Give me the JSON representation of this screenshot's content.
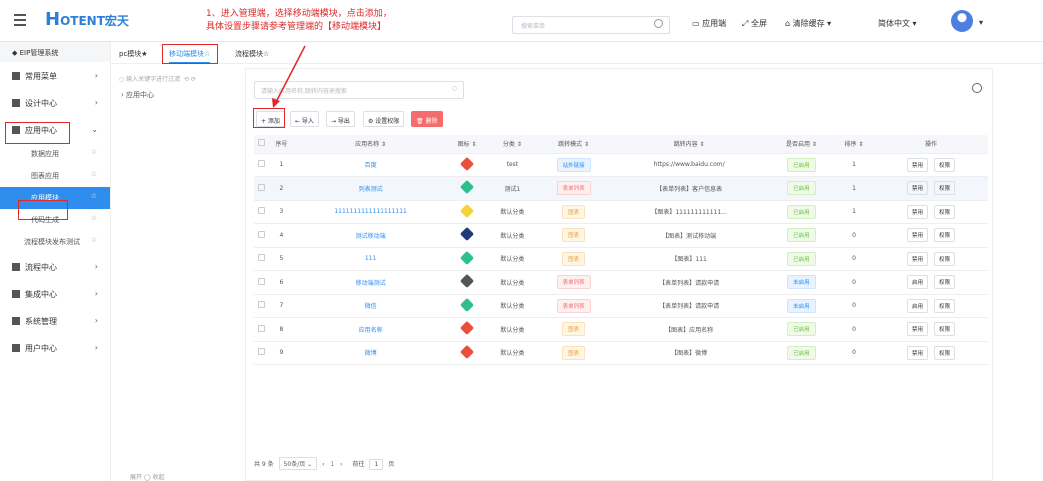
{
  "header": {
    "logo_main": "H",
    "logo_text": "OTENT",
    "logo_cn": "宏天",
    "hint_line1": "1、进入管理端，选择移动端模块，点击添加，",
    "hint_line2": "具体设置步骤请参考管理端的【移动端模块】",
    "search_placeholder": "搜索菜单",
    "app_end": "应用端",
    "fullscreen": "全屏",
    "clear_cache": "清除缓存",
    "language": "简体中文"
  },
  "sidebar": {
    "title": "EIP管理系统",
    "items": [
      {
        "label": "常用菜单"
      },
      {
        "label": "设计中心"
      },
      {
        "label": "应用中心"
      },
      {
        "label": "流程中心"
      },
      {
        "label": "集成中心"
      },
      {
        "label": "系统管理"
      },
      {
        "label": "用户中心"
      }
    ],
    "subitems": [
      "数据应用",
      "图表应用",
      "应用模块",
      "代码生成",
      "流程模块发布测试"
    ]
  },
  "tabs": [
    "pc模块★",
    "移动端模块☆",
    "流程模块☆"
  ],
  "tree": {
    "search_placeholder": "输入关键字进行过滤",
    "node": "应用中心"
  },
  "toolbar": {
    "key_placeholder": "请输入应用名称,跳转内容来搜索",
    "add": "+ 添加",
    "import": "← 导入",
    "export": "→ 导出",
    "perm": "⚙ 设置权限",
    "delete": "🗑 删除"
  },
  "table": {
    "headers": [
      "",
      "序号",
      "应用名称 ⇕",
      "图标 ⇕",
      "分类 ⇕",
      "跳转模式 ⇕",
      "跳转内容 ⇕",
      "是否启用 ⇕",
      "排序 ⇕",
      "操作"
    ],
    "rows": [
      {
        "no": "1",
        "name": "百度",
        "cat": "test",
        "mode": "站外链接",
        "content": "https://www.baidu.com/",
        "status": "已启用",
        "sort": "1",
        "op1": "禁用",
        "op2": "权限"
      },
      {
        "no": "2",
        "name": "列表测试",
        "cat": "测试1",
        "mode": "表单列表",
        "content": "【表单列表】客户信息表",
        "status": "已启用",
        "sort": "1",
        "op1": "禁用",
        "op2": "权限"
      },
      {
        "no": "3",
        "name": "1111111111111111111",
        "cat": "默认分类",
        "mode": "图表",
        "content": "【图表】111111111111...",
        "status": "已启用",
        "sort": "1",
        "op1": "禁用",
        "op2": "权限"
      },
      {
        "no": "4",
        "name": "测试移动端",
        "cat": "默认分类",
        "mode": "图表",
        "content": "【图表】测试移动端",
        "status": "已启用",
        "sort": "0",
        "op1": "禁用",
        "op2": "权限"
      },
      {
        "no": "5",
        "name": "111",
        "cat": "默认分类",
        "mode": "图表",
        "content": "【图表】111",
        "status": "已启用",
        "sort": "0",
        "op1": "禁用",
        "op2": "权限"
      },
      {
        "no": "6",
        "name": "移动端测试",
        "cat": "默认分类",
        "mode": "表单列表",
        "content": "【表单列表】请款申请",
        "status": "未启用",
        "sort": "0",
        "op1": "启用",
        "op2": "权限"
      },
      {
        "no": "7",
        "name": "微信",
        "cat": "默认分类",
        "mode": "表单列表",
        "content": "【表单列表】请款申请",
        "status": "未启用",
        "sort": "0",
        "op1": "启用",
        "op2": "权限"
      },
      {
        "no": "8",
        "name": "应用名称",
        "cat": "默认分类",
        "mode": "图表",
        "content": "【图表】应用名称",
        "status": "已启用",
        "sort": "0",
        "op1": "禁用",
        "op2": "权限"
      },
      {
        "no": "9",
        "name": "微博",
        "cat": "默认分类",
        "mode": "图表",
        "content": "【图表】微博",
        "status": "已启用",
        "sort": "0",
        "op1": "禁用",
        "op2": "权限"
      }
    ]
  },
  "pager": {
    "total": "共 9 条",
    "size": "50条/页",
    "page": "1",
    "goto": "前往",
    "goto_val": "1",
    "unit": "页"
  },
  "bottom": {
    "left": "展开",
    "right": "收起"
  }
}
